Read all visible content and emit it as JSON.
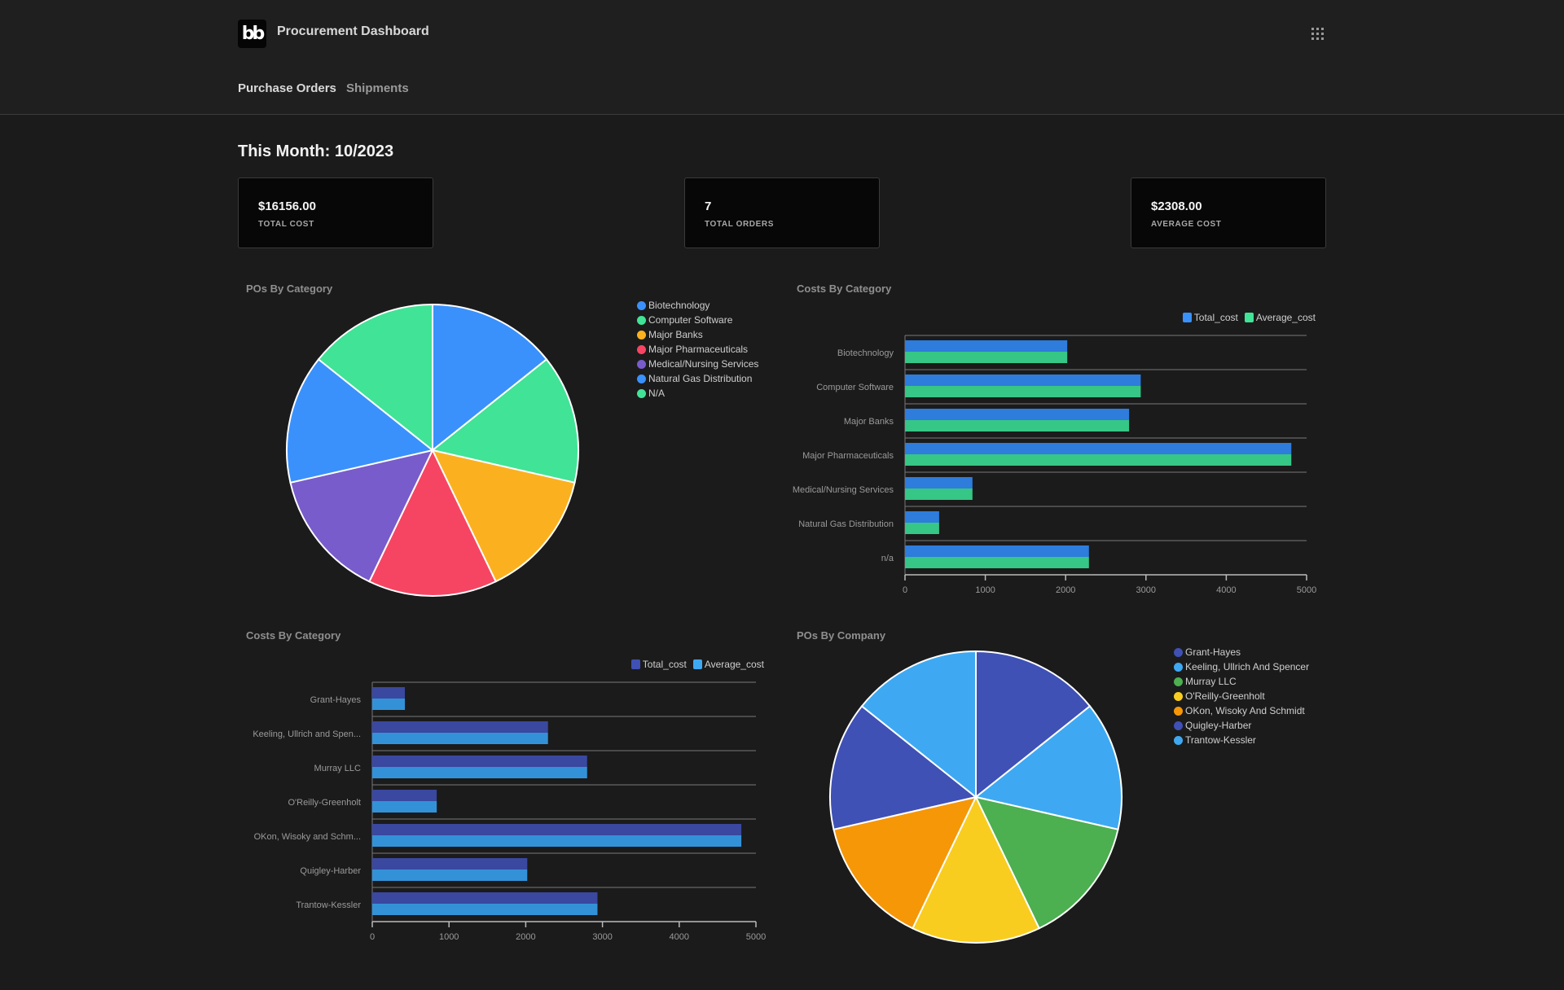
{
  "header": {
    "logo_text": "bb",
    "app_title": "Procurement Dashboard",
    "apps_icon": "grid-icon"
  },
  "tabs": [
    {
      "label": "Purchase Orders",
      "active": true
    },
    {
      "label": "Shipments",
      "active": false
    }
  ],
  "month_title": "This Month: 10/2023",
  "kpis": [
    {
      "value": "$16156.00",
      "label": "TOTAL COST"
    },
    {
      "value": "7",
      "label": "TOTAL ORDERS"
    },
    {
      "value": "$2308.00",
      "label": "AVERAGE COST"
    }
  ],
  "chart_data": [
    {
      "type": "pie",
      "title": "POs By Category",
      "labels": [
        "Biotechnology",
        "Computer Software",
        "Major Banks",
        "Major Pharmaceuticals",
        "Medical/Nursing Services",
        "Natural Gas Distribution",
        "N/A"
      ],
      "values": [
        1,
        1,
        1,
        1,
        1,
        1,
        1
      ],
      "colors": [
        "#3a91fb",
        "#41e396",
        "#fbb11f",
        "#f64563",
        "#785ccb",
        "#3a91fb",
        "#41e396"
      ],
      "legend": "right"
    },
    {
      "type": "bar",
      "orientation": "horizontal",
      "title": "Costs By Category",
      "categories": [
        "Biotechnology",
        "Computer Software",
        "Major Banks",
        "Major Pharmaceuticals",
        "Medical/Nursing Services",
        "Natural Gas Distribution",
        "n/a"
      ],
      "series": [
        {
          "name": "Total_cost",
          "color": "#2e7cdc",
          "values": [
            2020,
            2935,
            2790,
            4810,
            840,
            425,
            2290
          ]
        },
        {
          "name": "Average_cost",
          "color": "#36c685",
          "values": [
            2020,
            2935,
            2790,
            4810,
            840,
            425,
            2290
          ]
        }
      ],
      "legend_colors": [
        "#3a91fb",
        "#41e396"
      ],
      "xlim": [
        0,
        5000
      ],
      "xticks": [
        "0",
        "1000",
        "2000",
        "3000",
        "4000",
        "5000"
      ],
      "legend": "top-right",
      "grid": true
    },
    {
      "type": "bar",
      "orientation": "horizontal",
      "title": "Costs By Category",
      "categories": [
        "Grant-Hayes",
        "Keeling, Ullrich and Spen...",
        "Murray LLC",
        "O'Reilly-Greenholt",
        "OKon, Wisoky and Schm...",
        "Quigley-Harber",
        "Trantow-Kessler"
      ],
      "series": [
        {
          "name": "Total_cost",
          "color": "#3a489f",
          "values": [
            425,
            2290,
            2800,
            840,
            4810,
            2020,
            2935
          ]
        },
        {
          "name": "Average_cost",
          "color": "#3392d7",
          "values": [
            425,
            2290,
            2800,
            840,
            4810,
            2020,
            2935
          ]
        }
      ],
      "legend_colors": [
        "#3f51b5",
        "#3ea9f2"
      ],
      "xlim": [
        0,
        5000
      ],
      "xticks": [
        "0",
        "1000",
        "2000",
        "3000",
        "4000",
        "5000"
      ],
      "legend": "top-right",
      "grid": true
    },
    {
      "type": "pie",
      "title": "POs By Company",
      "labels": [
        "Grant-Hayes",
        "Keeling, Ullrich And Spencer",
        "Murray LLC",
        "O'Reilly-Greenholt",
        "OKon, Wisoky And Schmidt",
        "Quigley-Harber",
        "Trantow-Kessler"
      ],
      "values": [
        1,
        1,
        1,
        1,
        1,
        1,
        1
      ],
      "colors": [
        "#3f51b5",
        "#3ea9f2",
        "#4caf50",
        "#f9cd1f",
        "#f69707",
        "#3f51b5",
        "#3ea9f2"
      ],
      "legend": "right"
    }
  ]
}
